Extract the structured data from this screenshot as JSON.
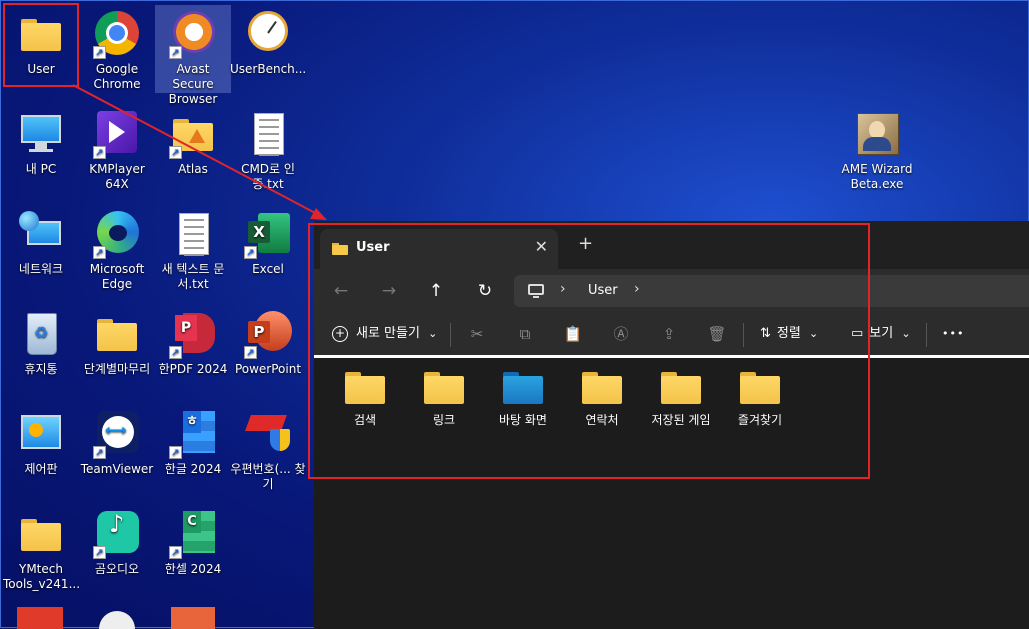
{
  "desktop": {
    "icons": [
      {
        "label": "User",
        "icon": "folder-icon"
      },
      {
        "label": "Google Chrome",
        "icon": "chrome-icon"
      },
      {
        "label": "Avast Secure Browser",
        "icon": "avast-browser-icon"
      },
      {
        "label": "UserBench...",
        "icon": "userbenchmark-icon"
      },
      {
        "label": "내 PC",
        "icon": "computer-icon"
      },
      {
        "label": "KMPlayer 64X",
        "icon": "kmplayer-icon"
      },
      {
        "label": "Atlas",
        "icon": "atlas-folder-icon"
      },
      {
        "label": "CMD로 인증.txt",
        "icon": "text-file-icon"
      },
      {
        "label": "네트워크",
        "icon": "network-icon"
      },
      {
        "label": "Microsoft Edge",
        "icon": "edge-icon"
      },
      {
        "label": "새 텍스트 문서.txt",
        "icon": "text-file-icon"
      },
      {
        "label": "Excel",
        "icon": "excel-icon"
      },
      {
        "label": "휴지통",
        "icon": "recycle-bin-icon"
      },
      {
        "label": "단계별마무리",
        "icon": "folder-icon"
      },
      {
        "label": "한PDF 2024",
        "icon": "hanpdf-icon"
      },
      {
        "label": "PowerPoint",
        "icon": "powerpoint-icon"
      },
      {
        "label": "제어판",
        "icon": "control-panel-icon"
      },
      {
        "label": "TeamViewer",
        "icon": "teamviewer-icon"
      },
      {
        "label": "한글 2024",
        "icon": "hangul-icon"
      },
      {
        "label": "우편번호(... 찾기",
        "icon": "postcode-icon"
      },
      {
        "label": "YMtech Tools_v241...",
        "icon": "folder-icon"
      },
      {
        "label": "곰오디오",
        "icon": "gomaudio-icon"
      },
      {
        "label": "한셀 2024",
        "icon": "hancell-icon"
      },
      {
        "label": "AME Wizard Beta.exe",
        "icon": "ame-wizard-icon"
      }
    ]
  },
  "explorer": {
    "tab_title": "User",
    "tab_close": "✕",
    "new_tab": "+",
    "nav": {
      "back": "←",
      "forward": "→",
      "up": "↑",
      "refresh": "↻",
      "sep": "›"
    },
    "breadcrumb": "User",
    "toolbar": {
      "new_label": "새로 만들기",
      "sort_label": "정렬",
      "view_label": "보기",
      "more": "•••",
      "chevron": "⌄"
    },
    "items": [
      {
        "label": "검색",
        "icon": "folder-icon"
      },
      {
        "label": "링크",
        "icon": "folder-icon"
      },
      {
        "label": "바탕 화면",
        "icon": "desktop-folder-icon"
      },
      {
        "label": "연락처",
        "icon": "folder-icon"
      },
      {
        "label": "저장된 게임",
        "icon": "folder-icon"
      },
      {
        "label": "즐겨찾기",
        "icon": "folder-icon"
      }
    ]
  },
  "colors": {
    "highlight": "#e0242a",
    "desktop": "#0f2d99",
    "explorer_bg": "#1c1c1c"
  }
}
